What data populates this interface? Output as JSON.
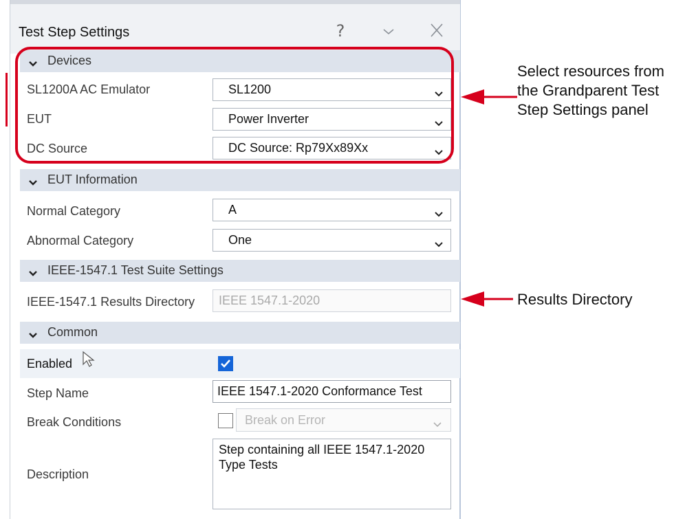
{
  "panel": {
    "title": "Test Step Settings",
    "help_glyph": "?",
    "sections": {
      "devices": "Devices",
      "eut_information": "EUT Information",
      "ieee_suite": "IEEE-1547.1 Test Suite Settings",
      "common": "Common"
    },
    "devices": {
      "ac_emulator_label": "SL1200A AC Emulator",
      "ac_emulator_value": "SL1200",
      "eut_label": "EUT",
      "eut_value": "Power Inverter",
      "dc_source_label": "DC Source",
      "dc_source_value": "DC Source: Rp79Xx89Xx"
    },
    "eut_information": {
      "normal_category_label": "Normal Category",
      "normal_category_value": "A",
      "abnormal_category_label": "Abnormal Category",
      "abnormal_category_value": "One"
    },
    "ieee_suite": {
      "results_directory_label": "IEEE-1547.1 Results Directory",
      "results_directory_value": "IEEE 1547.1-2020"
    },
    "common": {
      "enabled_label": "Enabled",
      "enabled_checked": true,
      "step_name_label": "Step Name",
      "step_name_value": "IEEE 1547.1-2020 Conformance Test",
      "break_conditions_label": "Break Conditions",
      "break_conditions_checked": false,
      "break_conditions_value": "Break on Error",
      "description_label": "Description",
      "description_value": "Step containing all IEEE 1547.1-2020 Type Tests"
    }
  },
  "annotations": {
    "select_resources": [
      "Select resources from",
      "the Grandparent Test",
      "Step Settings panel"
    ],
    "results_directory": "Results Directory"
  },
  "colors": {
    "callout_red": "#d6001c",
    "section_bg": "#dde3ec",
    "checkbox_blue": "#1565d8"
  }
}
